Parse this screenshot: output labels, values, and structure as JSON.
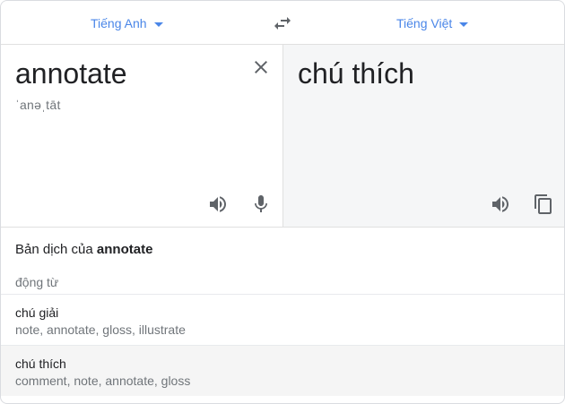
{
  "languages": {
    "source": "Tiếng Anh",
    "target": "Tiếng Việt"
  },
  "source_pane": {
    "text": "annotate",
    "phonetic": "ˈanəˌtāt"
  },
  "target_pane": {
    "text": "chú thích"
  },
  "dictionary": {
    "heading_prefix": "Bản dịch của",
    "heading_word": "annotate",
    "part_of_speech": "động từ",
    "entries": [
      {
        "word": "chú giải",
        "synonyms": "note, annotate, gloss, illustrate"
      },
      {
        "word": "chú thích",
        "synonyms": "comment, note, annotate, gloss"
      }
    ]
  },
  "icons": {
    "caret": "chevron-down-icon",
    "swap": "swap-icon",
    "clear": "close-icon",
    "speaker": "speaker-icon",
    "mic": "microphone-icon",
    "copy": "copy-icon"
  },
  "colors": {
    "accent": "#4a86e8",
    "icon": "#5f6368",
    "target_bg": "#f5f6f7"
  }
}
